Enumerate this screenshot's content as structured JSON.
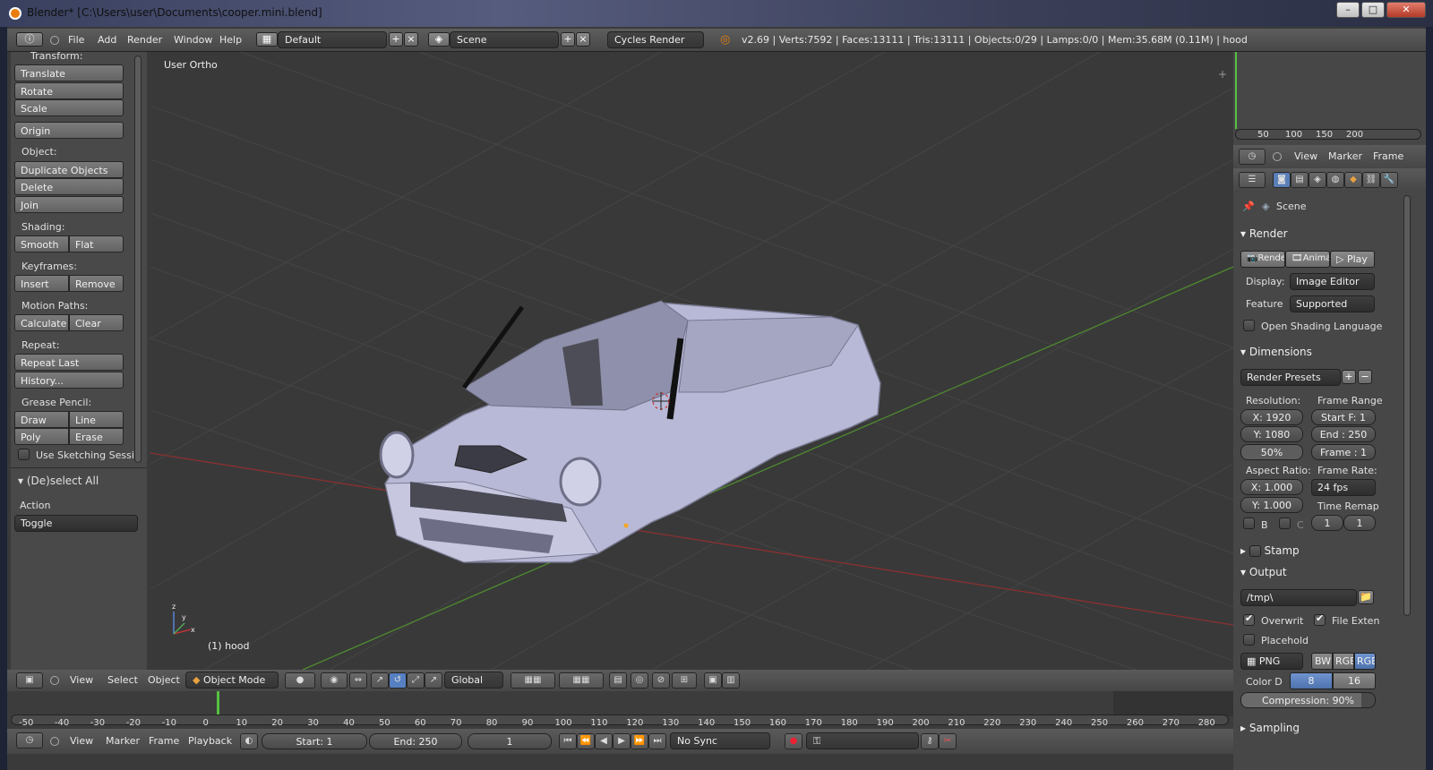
{
  "window": {
    "title": "Blender* [C:\\Users\\user\\Documents\\cooper.mini.blend]"
  },
  "info_header": {
    "menus": [
      "File",
      "Add",
      "Render",
      "Window",
      "Help"
    ],
    "layout": "Default",
    "scene": "Scene",
    "engine": "Cycles Render",
    "stats": "v2.69 | Verts:7592 | Faces:13111 | Tris:13111 | Objects:0/29 | Lamps:0/0 | Mem:35.68M (0.11M) | hood"
  },
  "toolshelf": {
    "transform_label": "Transform:",
    "translate": "Translate",
    "rotate": "Rotate",
    "scale": "Scale",
    "origin": "Origin",
    "object_label": "Object:",
    "duplicate": "Duplicate Objects",
    "delete": "Delete",
    "join": "Join",
    "shading_label": "Shading:",
    "smooth": "Smooth",
    "flat": "Flat",
    "keyframes_label": "Keyframes:",
    "insert": "Insert",
    "remove": "Remove",
    "motion_label": "Motion Paths:",
    "calculate": "Calculate",
    "clear": "Clear",
    "repeat_label": "Repeat:",
    "repeat_last": "Repeat Last",
    "history": "History...",
    "grease_label": "Grease Pencil:",
    "draw": "Draw",
    "line": "Line",
    "poly": "Poly",
    "erase": "Erase",
    "sketching": "Use Sketching Sessi",
    "operator_title": "(De)select All",
    "action_label": "Action",
    "action_value": "Toggle"
  },
  "viewport": {
    "view_name": "User Ortho",
    "object_name": "(1) hood"
  },
  "view3d_header": {
    "view": "View",
    "select": "Select",
    "object": "Object",
    "mode": "Object Mode",
    "orientation": "Global"
  },
  "timeline": {
    "ticks": [
      "-50",
      "-40",
      "-30",
      "-20",
      "-10",
      "0",
      "10",
      "20",
      "30",
      "40",
      "50",
      "60",
      "70",
      "80",
      "90",
      "100",
      "110",
      "120",
      "130",
      "140",
      "150",
      "160",
      "170",
      "180",
      "190",
      "200",
      "210",
      "220",
      "230",
      "240",
      "250",
      "260",
      "270",
      "280"
    ],
    "menus": [
      "View",
      "Marker",
      "Frame",
      "Playback"
    ],
    "start": "Start: 1",
    "end": "End: 250",
    "current": "1",
    "sync": "No Sync"
  },
  "mini_timeline": {
    "ticks": [
      "50",
      "100",
      "150",
      "200"
    ],
    "menus": [
      "View",
      "Marker",
      "Frame"
    ]
  },
  "properties": {
    "context": "Scene",
    "render_panel": "Render",
    "render_btn": "Rende",
    "anim_btn": "Anima",
    "play_btn": "Play",
    "display_label": "Display:",
    "display_value": "Image Editor",
    "feature_label": "Feature",
    "feature_value": "Supported",
    "osl": "Open Shading Language",
    "dimensions_panel": "Dimensions",
    "presets": "Render Presets",
    "resolution_label": "Resolution:",
    "res_x": "X: 1920",
    "res_y": "Y: 1080",
    "res_pct": "50%",
    "frame_range_label": "Frame Range",
    "start_f": "Start F: 1",
    "end_f": "End : 250",
    "frame_step": "Frame : 1",
    "aspect_label": "Aspect Ratio:",
    "asp_x": "X: 1.000",
    "asp_y": "Y: 1.000",
    "framerate_label": "Frame Rate:",
    "fps": "24 fps",
    "remap_label": "Time Remap",
    "remap_old": "1",
    "remap_new": "1",
    "border_b": "B",
    "border_c": "C",
    "stamp_panel": "Stamp",
    "output_panel": "Output",
    "output_path": "/tmp\\",
    "overwrite": "Overwrit",
    "file_ext": "File Exten",
    "placeholder": "Placehold",
    "format": "PNG",
    "bw": "BW",
    "rgb": "RGB",
    "rgba": "RGB",
    "color_depth_label": "Color D",
    "depth8": "8",
    "depth16": "16",
    "compression": "Compression: 90%",
    "sampling_panel": "Sampling"
  }
}
